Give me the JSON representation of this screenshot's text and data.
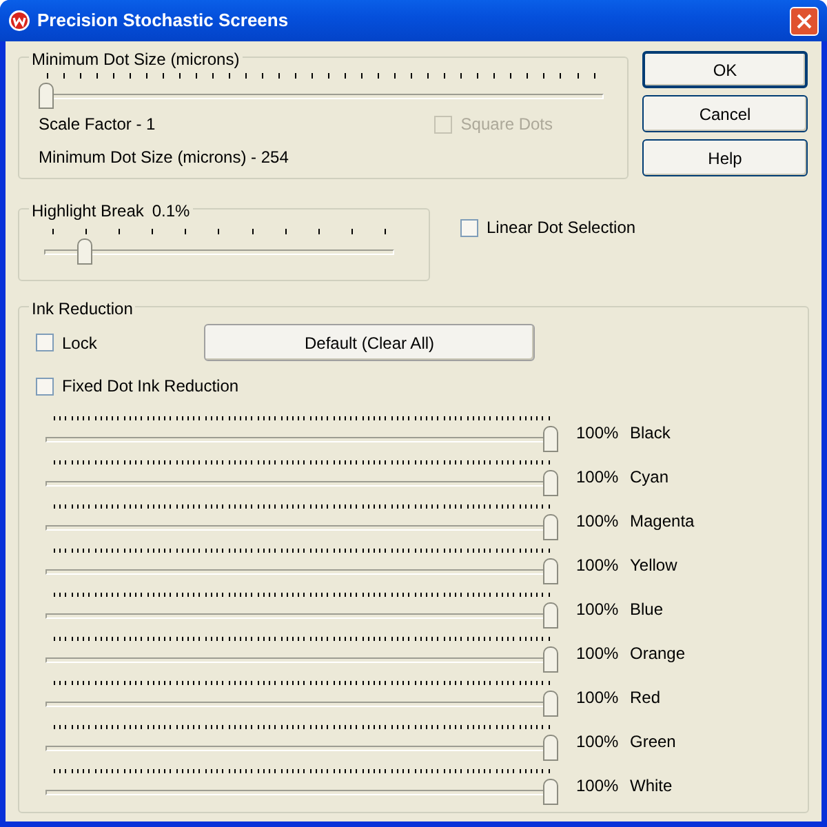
{
  "window": {
    "title": "Precision Stochastic Screens"
  },
  "min_dot_group": {
    "title": "Minimum Dot Size (microns)",
    "slider": {
      "level": 0.0
    },
    "scale_factor": "Scale Factor - 1",
    "square_dots": {
      "label": "Square Dots",
      "checked": false,
      "disabled": true
    },
    "min_dot_size": "Minimum Dot Size (microns) - 254"
  },
  "buttons": [
    "OK",
    "Cancel",
    "Help"
  ],
  "highlight_group": {
    "title": "Highlight Break",
    "value": "0.1%",
    "slider": {
      "level": 0.1
    }
  },
  "linear_dot_selection": {
    "label": "Linear Dot Selection",
    "checked": false,
    "disabled": false
  },
  "ink_reduction": {
    "title": "Ink Reduction",
    "lock": {
      "label": "Lock",
      "checked": false,
      "disabled": false
    },
    "default_button": "Default (Clear All)",
    "fixed_dot": {
      "label": "Fixed Dot Ink Reduction",
      "checked": false,
      "disabled": false
    },
    "inks": [
      {
        "level": 1,
        "percent": "100%",
        "name": "Black"
      },
      {
        "level": 1,
        "percent": "100%",
        "name": "Cyan"
      },
      {
        "level": 1,
        "percent": "100%",
        "name": "Magenta"
      },
      {
        "level": 1,
        "percent": "100%",
        "name": "Yellow"
      },
      {
        "level": 1,
        "percent": "100%",
        "name": "Blue"
      },
      {
        "level": 1,
        "percent": "100%",
        "name": "Orange"
      },
      {
        "level": 1,
        "percent": "100%",
        "name": "Red"
      },
      {
        "level": 1,
        "percent": "100%",
        "name": "Green"
      },
      {
        "level": 1,
        "percent": "100%",
        "name": "White"
      }
    ]
  }
}
